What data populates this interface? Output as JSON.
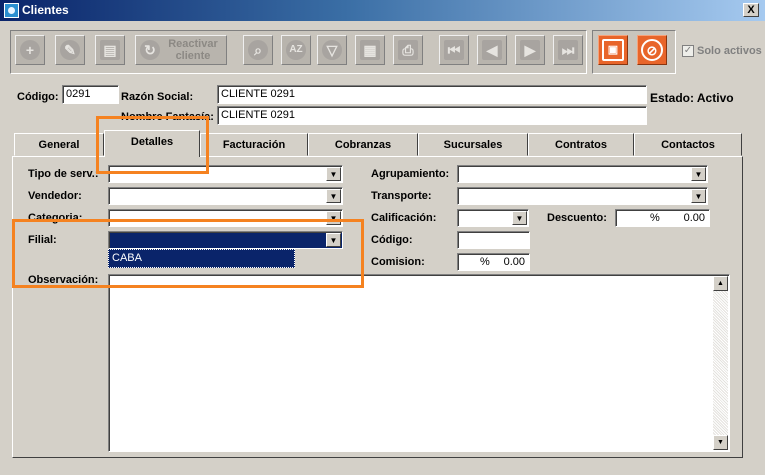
{
  "window": {
    "title": "Clientes",
    "close_label": "X"
  },
  "toolbar": {
    "reactivar_label": "Reactivar cliente",
    "solo_activos_label": "Solo activos",
    "solo_activos_checked": "✓"
  },
  "header": {
    "codigo_label": "Código:",
    "codigo_value": "0291",
    "razon_social_label": "Razón Social:",
    "razon_social_value": "CLIENTE 0291",
    "nombre_fantasia_label": "Nombre Fantasía:",
    "nombre_fantasia_value": "CLIENTE 0291",
    "estado_text": "Estado: Activo"
  },
  "tabs": [
    "General",
    "Detalles",
    "Facturación",
    "Cobranzas",
    "Sucursales",
    "Contratos",
    "Contactos"
  ],
  "detalles": {
    "tipo_servicio_label": "Tipo de serv.:",
    "vendedor_label": "Vendedor:",
    "categoria_label": "Categoria:",
    "filial_label": "Filial:",
    "filial_value": "",
    "filial_option": "CABA",
    "observacion_label": "Observación:",
    "agrupamiento_label": "Agrupamiento:",
    "transporte_label": "Transporte:",
    "calificacion_label": "Calificación:",
    "descuento_label": "Descuento:",
    "descuento_percent": "%",
    "descuento_value": "0.00",
    "codigo_label": "Código:",
    "comision_label": "Comision:",
    "comision_percent": "%",
    "comision_value": "0.00"
  }
}
